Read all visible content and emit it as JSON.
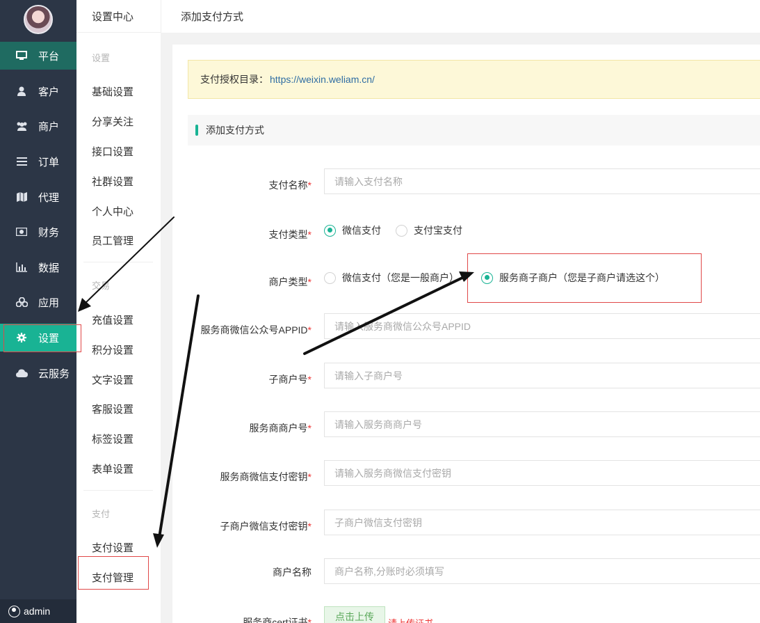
{
  "sidebar": {
    "items": [
      {
        "label": "平台",
        "icon": "monitor-icon"
      },
      {
        "label": "客户",
        "icon": "user-icon"
      },
      {
        "label": "商户",
        "icon": "users-icon"
      },
      {
        "label": "订单",
        "icon": "list-icon"
      },
      {
        "label": "代理",
        "icon": "map-icon"
      },
      {
        "label": "财务",
        "icon": "money-icon"
      },
      {
        "label": "数据",
        "icon": "bar-chart-icon"
      },
      {
        "label": "应用",
        "icon": "cubes-icon"
      },
      {
        "label": "设置",
        "icon": "gear-icon"
      },
      {
        "label": "云服务",
        "icon": "cloud-icon"
      }
    ],
    "user": "admin"
  },
  "submenu": {
    "title": "设置中心",
    "sections": [
      {
        "title": "设置",
        "items": [
          "基础设置",
          "分享关注",
          "接口设置",
          "社群设置",
          "个人中心",
          "员工管理"
        ]
      },
      {
        "title": "交易",
        "items": [
          "充值设置",
          "积分设置",
          "文字设置",
          "客服设置",
          "标签设置",
          "表单设置"
        ]
      },
      {
        "title": "支付",
        "items": [
          "支付设置",
          "支付管理"
        ]
      }
    ]
  },
  "topbar": {
    "title": "添加支付方式"
  },
  "notice": {
    "label": "支付授权目录：",
    "url": "https://weixin.weliam.cn/"
  },
  "section": {
    "title": "添加支付方式"
  },
  "form": {
    "pay_name": {
      "label": "支付名称",
      "placeholder": "请输入支付名称"
    },
    "pay_type": {
      "label": "支付类型",
      "options": [
        "微信支付",
        "支付宝支付"
      ],
      "selected": "微信支付"
    },
    "merchant_type": {
      "label": "商户类型",
      "options": [
        "微信支付（您是一般商户）",
        "服务商子商户（您是子商户请选这个）"
      ],
      "selected": "服务商子商户（您是子商户请选这个）"
    },
    "appid": {
      "label": "服务商微信公众号APPID",
      "placeholder": "请输入服务商微信公众号APPID"
    },
    "sub_mch_id": {
      "label": "子商户号",
      "placeholder": "请输入子商户号"
    },
    "sp_mch_id": {
      "label": "服务商商户号",
      "placeholder": "请输入服务商商户号"
    },
    "sp_key": {
      "label": "服务商微信支付密钥",
      "placeholder": "请输入服务商微信支付密钥"
    },
    "sub_key": {
      "label": "子商户微信支付密钥",
      "placeholder": "子商户微信支付密钥"
    },
    "mch_name": {
      "label": "商户名称",
      "placeholder": "商户名称,分账时必须填写"
    },
    "cert": {
      "label": "服务商cert证书",
      "button": "点击上传",
      "tip": "请上传证书"
    }
  }
}
